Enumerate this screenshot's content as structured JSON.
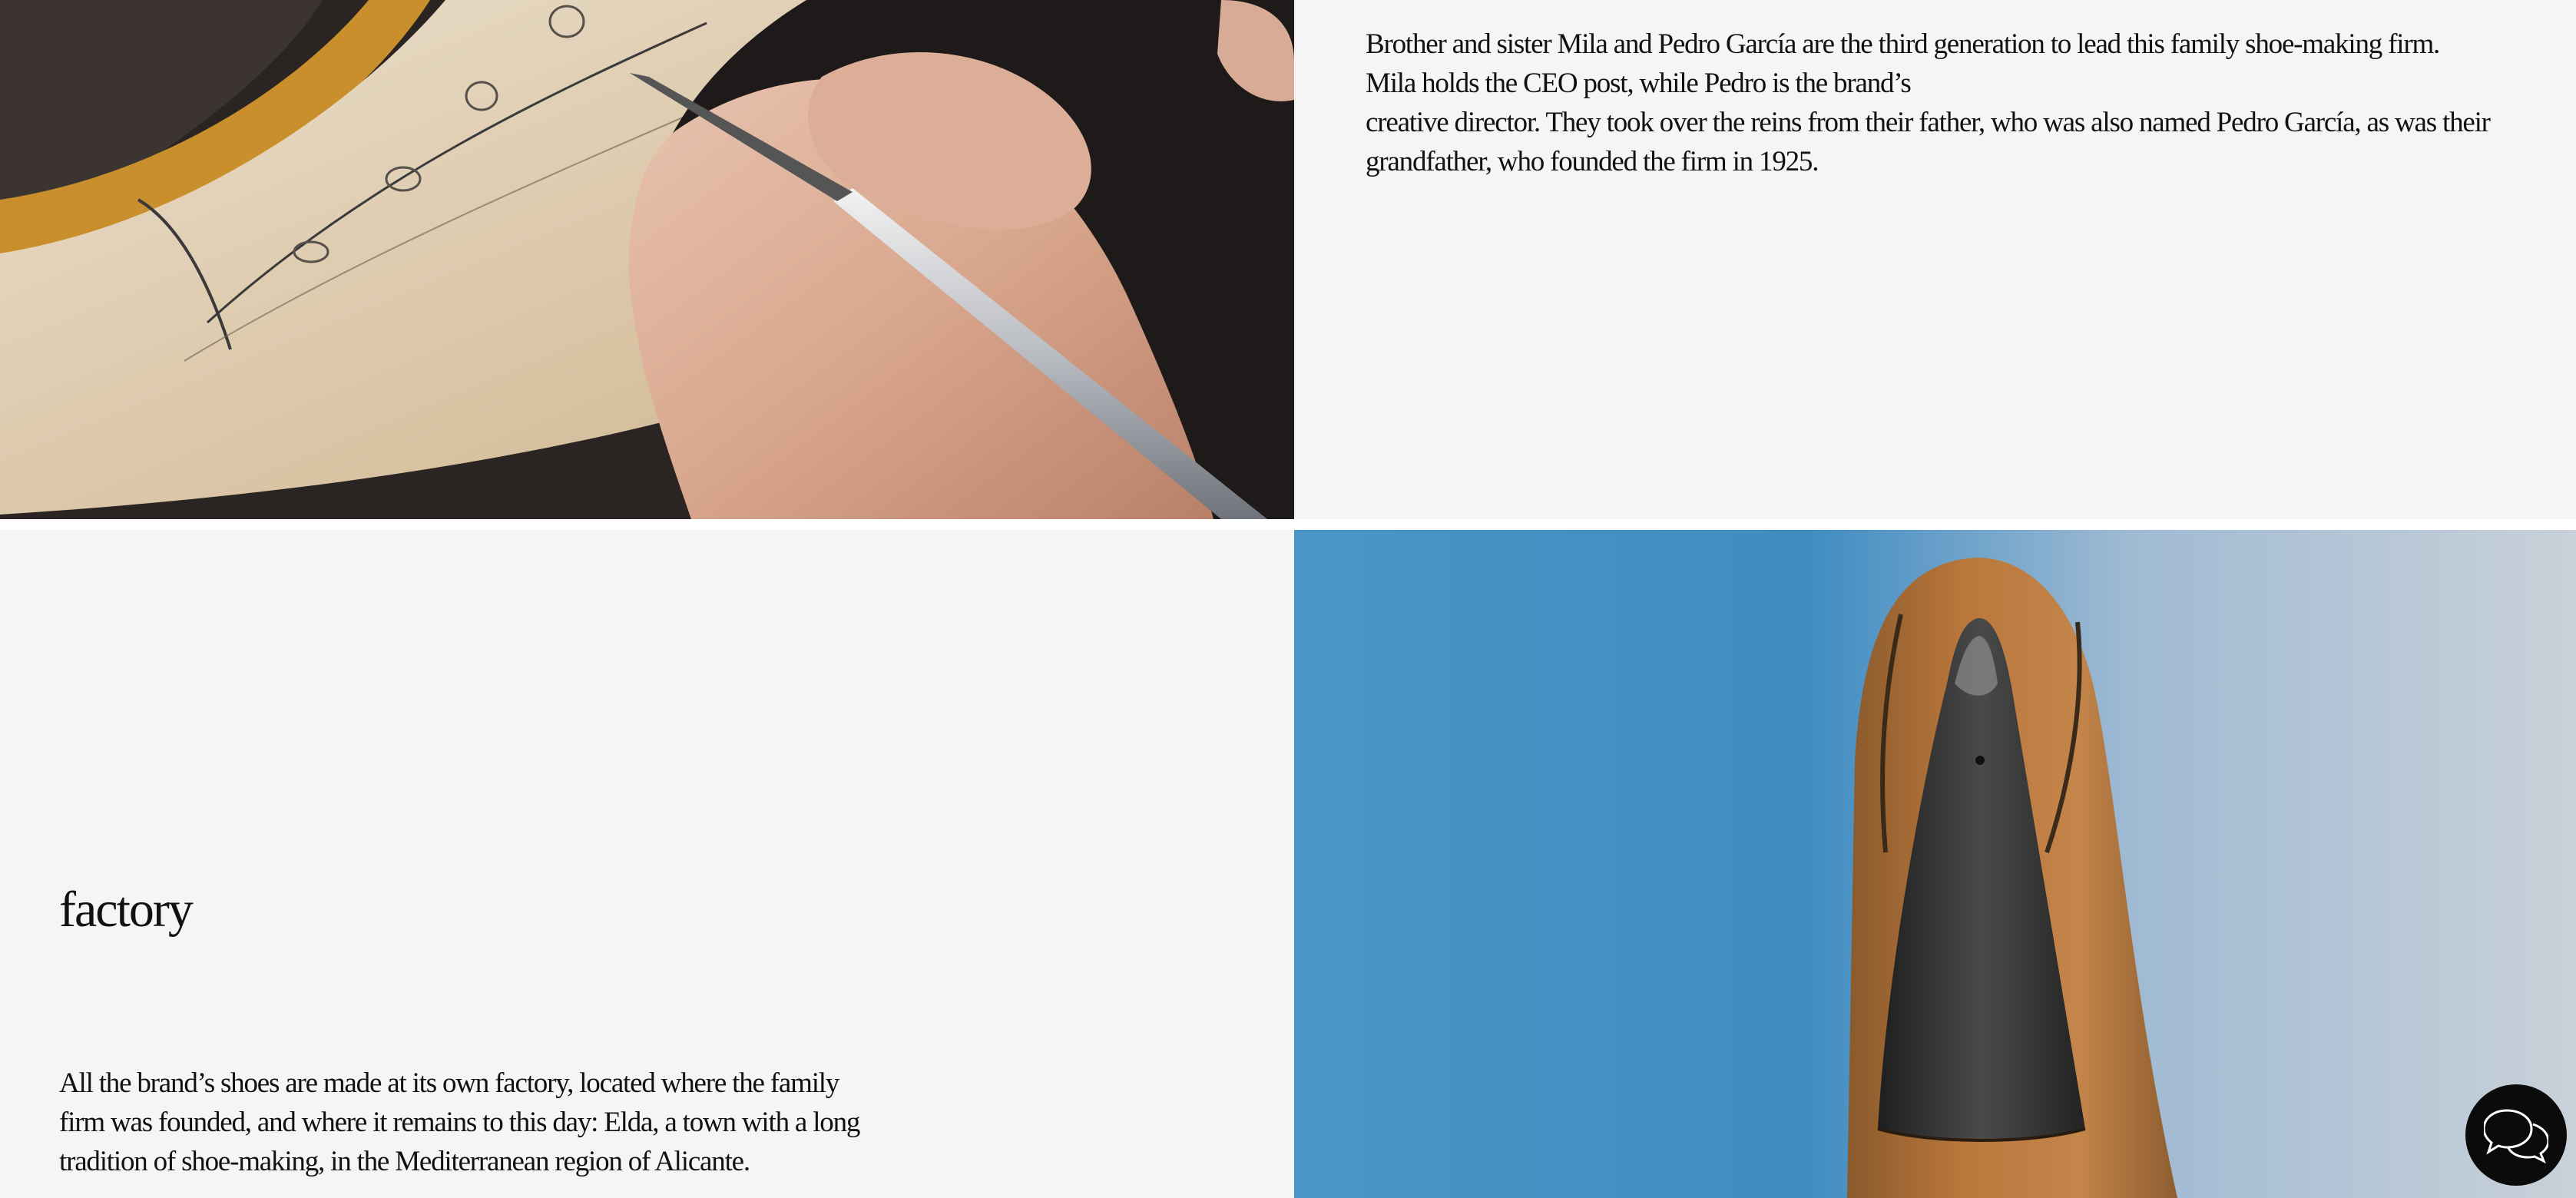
{
  "story": {
    "intro_paragraph": "Brother and sister Mila and Pedro García are the third generation to lead this family shoe-making firm. Mila holds the CEO post, while Pedro is the brand’s\ncreative director. They took over the reins from their father, who was also named Pedro García, as was their grandfather, who founded the firm in 1925."
  },
  "factory": {
    "heading": "factory",
    "paragraph": "All the brand’s shoes are made at its own factory, located where the family firm was founded, and where it remains to this day: Elda, a town with a long tradition of shoe-making, in the Mediterranean region of Alicante."
  },
  "images": {
    "sketch": "hand-drawing-pattern-on-shoe-last-photo",
    "last": "suede-shoe-upper-on-last-photo"
  },
  "chat": {
    "icon": "chat-bubbles-icon"
  },
  "colors": {
    "panel_background": "#f5f5f5",
    "text": "#111111",
    "chat_button": "#0b0b0b"
  }
}
